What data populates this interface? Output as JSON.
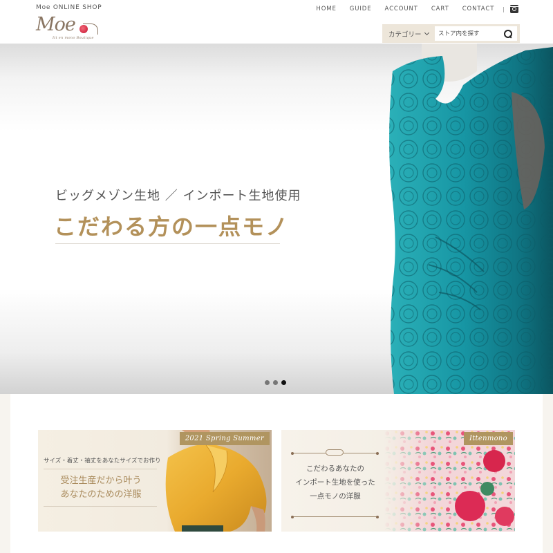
{
  "header": {
    "shop_name": "Moe ONLINE SHOP",
    "logo_text": "Moe",
    "logo_tagline": "Itt en mono Boutique",
    "nav": [
      {
        "label": "HOME"
      },
      {
        "label": "GUIDE"
      },
      {
        "label": "ACCOUNT"
      },
      {
        "label": "CART"
      },
      {
        "label": "CONTACT"
      }
    ],
    "nav_separator": "|",
    "social_icon": "instagram-icon",
    "category_label": "カテゴリー",
    "search_placeholder": "ストア内を探す",
    "search_icon": "search-icon"
  },
  "hero": {
    "subtitle": "ビッグメゾン生地 ／ インポート生地使用",
    "title": "こだわる方の一点モノ",
    "slides_total": 3,
    "active_slide": 3,
    "image_desc": "teal jacquard dress on mannequin"
  },
  "banners": [
    {
      "tag": "2021 Spring Summer",
      "line1": "サイズ・着丈・袖丈をあなたサイズでお作り",
      "title_line1": "受注生産だから叶う",
      "title_line2": "あなたのための洋服",
      "image_desc": "yellow satin bow blouse"
    },
    {
      "tag": "Ittenmono",
      "text_line1": "こだわるあなたの",
      "text_line2": "インポート生地を使った",
      "text_line3": "一点モノの洋服",
      "image_desc": "floral rose print fabric"
    }
  ],
  "colors": {
    "accent_gold": "#b3915a",
    "tag_gold": "#b09560",
    "search_bg": "#ede6da",
    "page_bg": "#f7f4ef",
    "dress_teal": "#1a98a6"
  }
}
